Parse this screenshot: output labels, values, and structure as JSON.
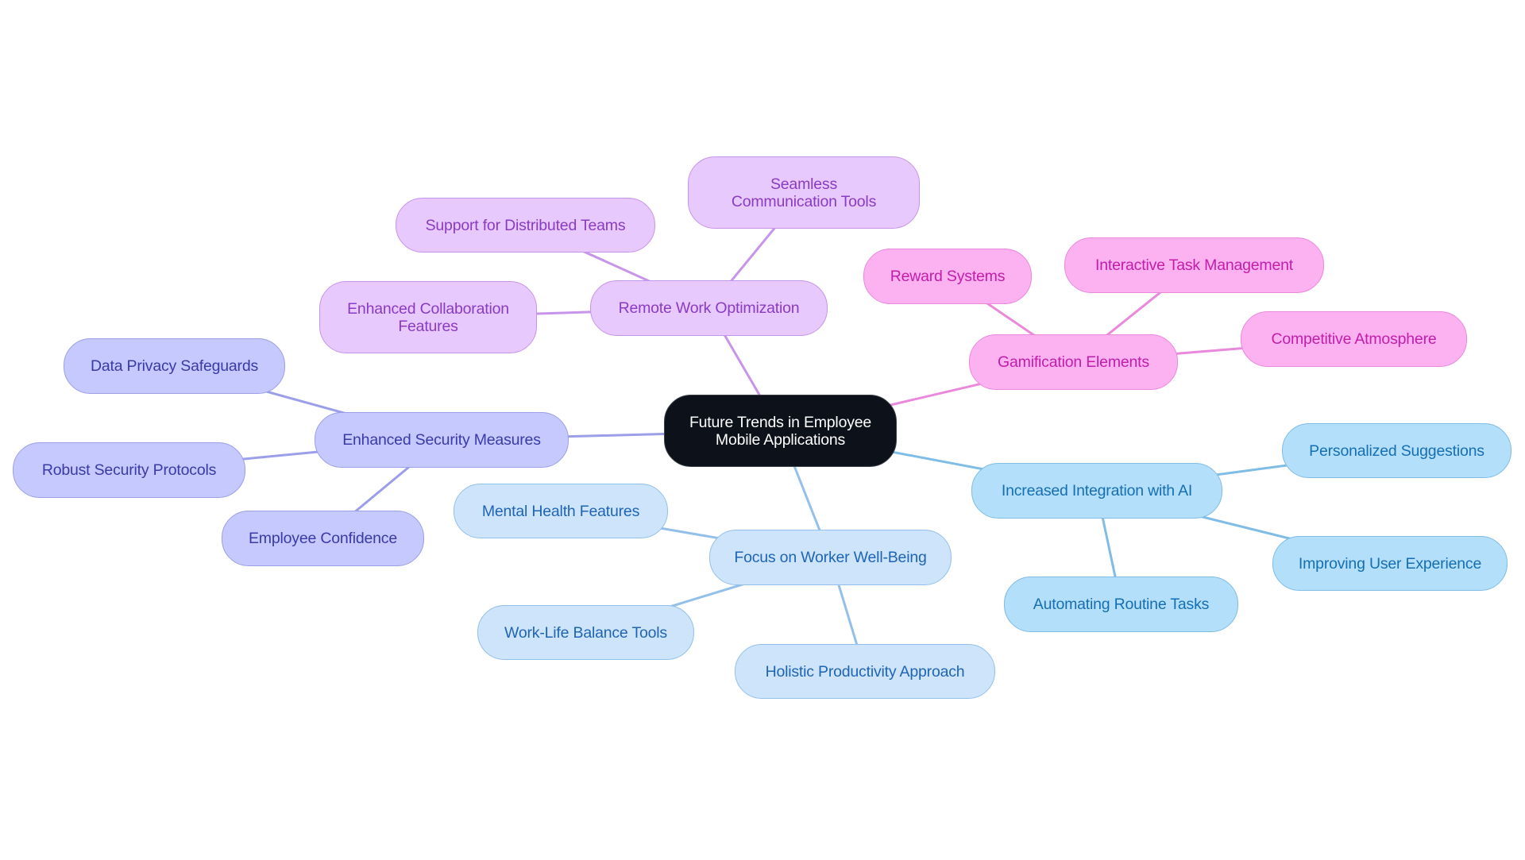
{
  "title": "Future Trends in Employee Mobile Applications",
  "colors": {
    "root": "#0d121a",
    "purple_branch_line": "#c794ea",
    "pink_branch_line": "#ea88dc",
    "indigo_branch_line": "#9b9ee8",
    "lightblue_branch_line": "#93c0ea",
    "sky_branch_line": "#7fbce6"
  },
  "mindmap": {
    "root": {
      "label": "Future Trends in Employee Mobile Applications"
    },
    "branches": [
      {
        "label": "Remote Work Optimization",
        "children": [
          "Seamless Communication Tools",
          "Support for Distributed Teams",
          "Enhanced Collaboration Features"
        ]
      },
      {
        "label": "Gamification Elements",
        "children": [
          "Reward Systems",
          "Interactive Task Management",
          "Competitive Atmosphere"
        ]
      },
      {
        "label": "Enhanced Security Measures",
        "children": [
          "Data Privacy Safeguards",
          "Robust Security Protocols",
          "Employee Confidence"
        ]
      },
      {
        "label": "Focus on Worker Well-Being",
        "children": [
          "Mental Health Features",
          "Work-Life Balance Tools",
          "Holistic Productivity Approach"
        ]
      },
      {
        "label": "Increased Integration with AI",
        "children": [
          "Personalized Suggestions",
          "Improving User Experience",
          "Automating Routine Tasks"
        ]
      }
    ]
  }
}
